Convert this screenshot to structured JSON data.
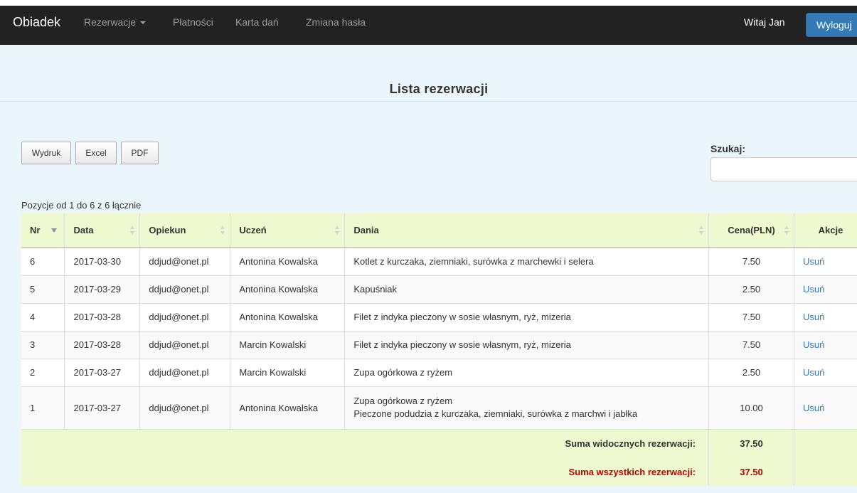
{
  "navbar": {
    "brand": "Obiadek",
    "items": [
      {
        "label": "Rezerwacje",
        "dropdown": true
      },
      {
        "label": "Płatności"
      },
      {
        "label": "Karta dań"
      },
      {
        "label": "Zmiana hasła"
      }
    ],
    "welcome": "Witaj Jan",
    "logout_label": "Wyloguj"
  },
  "page": {
    "title": "Lista rezerwacji"
  },
  "toolbar": {
    "print_label": "Wydruk",
    "excel_label": "Excel",
    "pdf_label": "PDF"
  },
  "search": {
    "label": "Szukaj:",
    "value": ""
  },
  "info": "Pozycje od 1 do 6 z 6 łącznie",
  "table": {
    "columns": [
      "Nr",
      "Data",
      "Opiekun",
      "Uczeń",
      "Dania",
      "Cena(PLN)",
      "Akcje"
    ],
    "rows": [
      {
        "nr": "6",
        "date": "2017-03-30",
        "guardian": "ddjud@onet.pl",
        "student": "Antonina Kowalska",
        "dishes": [
          "Kotlet z kurczaka, ziemniaki, surówka z marchewki i selera"
        ],
        "price": "7.50",
        "action": "Usuń"
      },
      {
        "nr": "5",
        "date": "2017-03-29",
        "guardian": "ddjud@onet.pl",
        "student": "Antonina Kowalska",
        "dishes": [
          "Kapuśniak"
        ],
        "price": "2.50",
        "action": "Usuń"
      },
      {
        "nr": "4",
        "date": "2017-03-28",
        "guardian": "ddjud@onet.pl",
        "student": "Antonina Kowalska",
        "dishes": [
          "Filet z indyka pieczony w sosie własnym, ryż, mizeria"
        ],
        "price": "7.50",
        "action": "Usuń"
      },
      {
        "nr": "3",
        "date": "2017-03-28",
        "guardian": "ddjud@onet.pl",
        "student": "Marcin Kowalski",
        "dishes": [
          "Filet z indyka pieczony w sosie własnym, ryż, mizeria"
        ],
        "price": "7.50",
        "action": "Usuń"
      },
      {
        "nr": "2",
        "date": "2017-03-27",
        "guardian": "ddjud@onet.pl",
        "student": "Marcin Kowalski",
        "dishes": [
          "Zupa ogórkowa z ryżem"
        ],
        "price": "2.50",
        "action": "Usuń"
      },
      {
        "nr": "1",
        "date": "2017-03-27",
        "guardian": "ddjud@onet.pl",
        "student": "Antonina Kowalska",
        "dishes": [
          "Zupa ogórkowa z ryżem",
          "Pieczone podudzia z kurczaka, ziemniaki, surówka z marchwi i jabłka"
        ],
        "price": "10.00",
        "action": "Usuń"
      }
    ],
    "sum_visible_label": "Suma widocznych rezerwacji:",
    "sum_visible_value": "37.50",
    "sum_all_label": "Suma wszystkich rezerwacji:",
    "sum_all_value": "37.50"
  },
  "colors": {
    "navbar_bg": "#222222",
    "logout_bg": "#337ab7",
    "header_bg": "#eff9d0",
    "page_bg": "#ebf6fc",
    "sum_all_color": "#c00000",
    "link": "#337ab7"
  }
}
